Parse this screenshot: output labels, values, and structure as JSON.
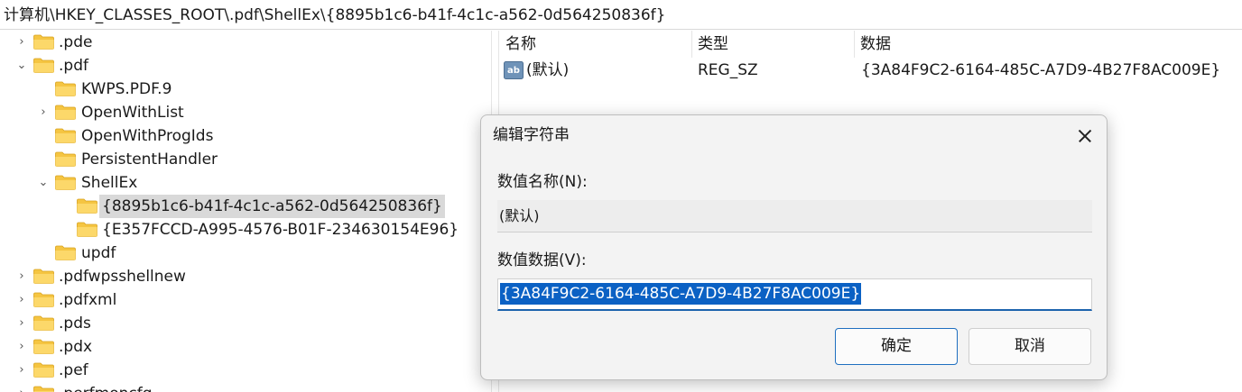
{
  "address": "计算机\\HKEY_CLASSES_ROOT\\.pdf\\ShellEx\\{8895b1c6-b41f-4c1c-a562-0d564250836f}",
  "tree": {
    "items": [
      {
        "label": ".pde",
        "expander": "right"
      },
      {
        "label": ".pdf",
        "expander": "down"
      },
      {
        "label": "KWPS.PDF.9",
        "expander": ""
      },
      {
        "label": "OpenWithList",
        "expander": "right"
      },
      {
        "label": "OpenWithProgIds",
        "expander": ""
      },
      {
        "label": "PersistentHandler",
        "expander": ""
      },
      {
        "label": "ShellEx",
        "expander": "down"
      },
      {
        "label": "{8895b1c6-b41f-4c1c-a562-0d564250836f}",
        "expander": "",
        "selected": true
      },
      {
        "label": "{E357FCCD-A995-4576-B01F-234630154E96}",
        "expander": ""
      },
      {
        "label": "updf",
        "expander": ""
      },
      {
        "label": ".pdfwpsshellnew",
        "expander": "right"
      },
      {
        "label": ".pdfxml",
        "expander": "right"
      },
      {
        "label": ".pds",
        "expander": "right"
      },
      {
        "label": ".pdx",
        "expander": "right"
      },
      {
        "label": ".pef",
        "expander": "right"
      },
      {
        "label": ".perfmoncfg",
        "expander": "right"
      }
    ]
  },
  "values": {
    "headers": {
      "name": "名称",
      "type": "类型",
      "data": "数据"
    },
    "rows": [
      {
        "name": "(默认)",
        "type": "REG_SZ",
        "data": "{3A84F9C2-6164-485C-A7D9-4B27F8AC009E}"
      }
    ]
  },
  "dialog": {
    "title": "编辑字符串",
    "name_label": "数值名称(N):",
    "name_value": "(默认)",
    "data_label": "数值数据(V):",
    "data_value": "{3A84F9C2-6164-485C-A7D9-4B27F8AC009E}",
    "ok_label": "确定",
    "cancel_label": "取消"
  },
  "colors": {
    "folder": "#f5c542",
    "selection": "#0b61c4",
    "accent": "#1c63ad"
  }
}
